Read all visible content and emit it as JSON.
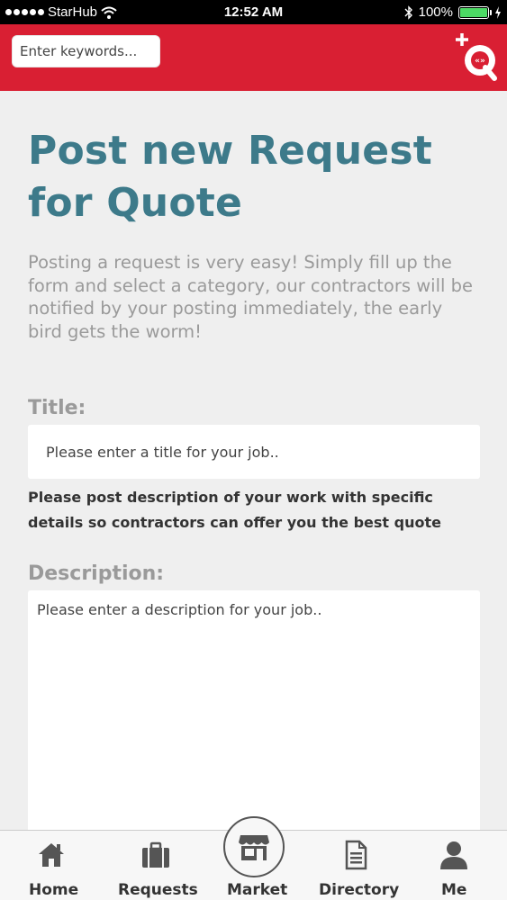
{
  "status_bar": {
    "carrier": "StarHub",
    "time": "12:52 AM",
    "battery": "100%",
    "battery_level": 1.0
  },
  "header": {
    "search": {
      "placeholder": "Enter keywords..."
    },
    "post_button_icon": "post-quote-icon",
    "accent_color": "#d91f33"
  },
  "page": {
    "title": "Post new Request for Quote",
    "intro": "Posting a request is very easy! Simply fill up the form and select a category, our contractors will be notified by your posting immediately, the early bird gets the worm!",
    "title_color": "#3d7a8a"
  },
  "form": {
    "title_label": "Title:",
    "title_placeholder": "Please enter a title for your job..",
    "hint": "Please post description of your work with specific details so contractors can offer you the best quote",
    "description_label": "Description:",
    "description_placeholder": "Please enter a description for your job.."
  },
  "tabs": [
    {
      "label": "Home",
      "icon": "home-icon"
    },
    {
      "label": "Requests",
      "icon": "briefcase-icon"
    },
    {
      "label": "Market",
      "icon": "store-icon"
    },
    {
      "label": "Directory",
      "icon": "document-icon"
    },
    {
      "label": "Me",
      "icon": "user-icon"
    }
  ]
}
